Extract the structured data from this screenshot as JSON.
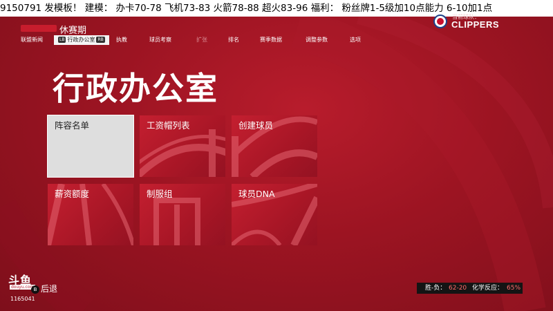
{
  "ticker": "9150791 发模板！  建模：  办卡70-78 飞机73-83 火箭78-88 超火83-96  福利：  粉丝牌1-5级加10点能力 6-10加1点",
  "header": {
    "season": "休赛期",
    "team_caption": "当前球队：",
    "team_name": "CLIPPERS",
    "team_logo_icon": "clippers-logo-icon"
  },
  "nav": {
    "items": [
      {
        "label": "联盟新闻",
        "state": "normal"
      },
      {
        "label": "行政办公室",
        "state": "active"
      },
      {
        "label": "执教",
        "state": "normal"
      },
      {
        "label": "球员考察",
        "state": "normal"
      },
      {
        "label": "扩张",
        "state": "disabled"
      },
      {
        "label": "排名",
        "state": "normal"
      },
      {
        "label": "赛季数据",
        "state": "normal"
      },
      {
        "label": "调整参数",
        "state": "normal"
      },
      {
        "label": "选项",
        "state": "normal"
      }
    ],
    "left_key": "LB",
    "right_key": "RB"
  },
  "title": "行政办公室",
  "tiles": [
    {
      "label": "阵容名单",
      "selected": true
    },
    {
      "label": "工资帽列表",
      "selected": false
    },
    {
      "label": "创建球员",
      "selected": false
    },
    {
      "label": "薪资额度",
      "selected": false
    },
    {
      "label": "制服组",
      "selected": false
    },
    {
      "label": "球员DNA",
      "selected": false
    }
  ],
  "footer": {
    "brand": "斗鱼",
    "brand_sub": "douyu.com",
    "room_id": "1165041",
    "back_key": "B",
    "back_label": "后退",
    "record_label": "胜-负：",
    "record_value": "62-20",
    "chemistry_label": "化学反应：",
    "chemistry_value": "65%"
  },
  "colors": {
    "background": "#9c1422",
    "tile": "#c41f30",
    "tile_selected": "#dedede",
    "highlight": "#ff6b6b"
  }
}
